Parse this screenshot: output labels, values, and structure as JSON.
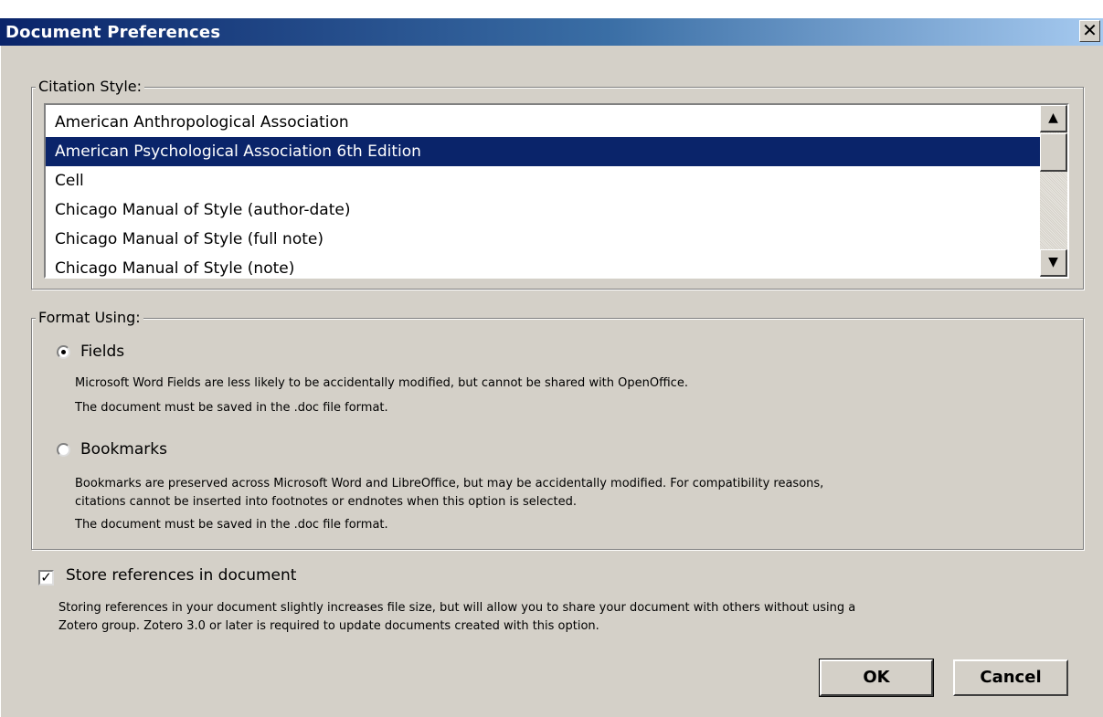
{
  "window": {
    "title": "Document Preferences",
    "close_glyph": "✕"
  },
  "citation_style": {
    "legend": "Citation Style:",
    "items": [
      "American Anthropological Association",
      "American Psychological Association 6th Edition",
      "Cell",
      "Chicago Manual of Style (author-date)",
      "Chicago Manual of Style (full note)",
      "Chicago Manual of Style (note)"
    ],
    "selected_index": 1,
    "scroll_up_glyph": "▲",
    "scroll_down_glyph": "▼"
  },
  "format_using": {
    "legend": "Format Using:",
    "fields": {
      "label": "Fields",
      "checked": true,
      "desc_line1": "Microsoft Word Fields are less likely to be accidentally modified, but cannot be shared with OpenOffice.",
      "desc_line2": "The document must be saved in the .doc file format."
    },
    "bookmarks": {
      "label": "Bookmarks",
      "checked": false,
      "desc_line1": "Bookmarks are preserved across Microsoft Word and LibreOffice, but may be accidentally modified. For compatibility reasons,",
      "desc_line2": "citations cannot be inserted into footnotes or endnotes when this option is selected.",
      "desc_line3": "The document must be saved in the .doc file format."
    }
  },
  "store_references": {
    "label": "Store references in document",
    "checked": true,
    "check_glyph": "✓",
    "desc_line1": "Storing references in your document slightly increases file size, but will allow you to share your document with others without using a",
    "desc_line2": "Zotero group. Zotero 3.0 or later is required to update documents created with this option."
  },
  "buttons": {
    "ok": "OK",
    "cancel": "Cancel"
  }
}
